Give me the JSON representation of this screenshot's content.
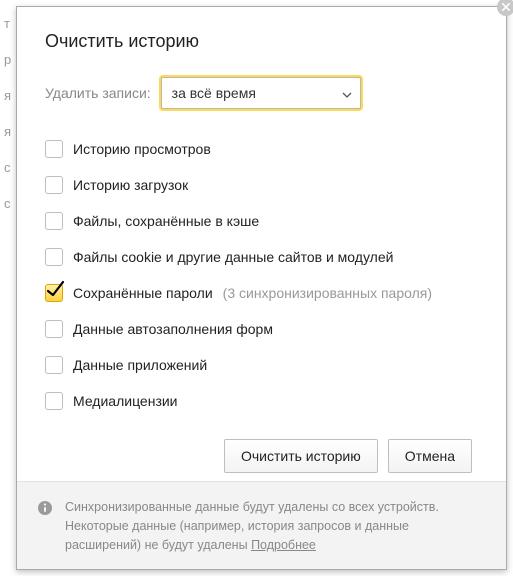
{
  "dialog": {
    "title": "Очистить историю",
    "time_label": "Удалить записи:",
    "time_select": {
      "value": "за всё время"
    },
    "options": [
      {
        "label": "Историю просмотров",
        "checked": false
      },
      {
        "label": "Историю загрузок",
        "checked": false
      },
      {
        "label": "Файлы, сохранённые в кэше",
        "checked": false
      },
      {
        "label": "Файлы cookie и другие данные сайтов и модулей",
        "checked": false
      },
      {
        "label": "Сохранённые пароли",
        "hint": "(3 синхронизированных пароля)",
        "checked": true
      },
      {
        "label": "Данные автозаполнения форм",
        "checked": false
      },
      {
        "label": "Данные приложений",
        "checked": false
      },
      {
        "label": "Медиалицензии",
        "checked": false
      }
    ],
    "actions": {
      "clear": "Очистить историю",
      "cancel": "Отмена"
    },
    "footer": {
      "text": "Синхронизированные данные будут удалены со всех устройств. Некоторые данные (например, история запросов и данные расширений) не будут удалены ",
      "link": "Подробнее"
    }
  }
}
